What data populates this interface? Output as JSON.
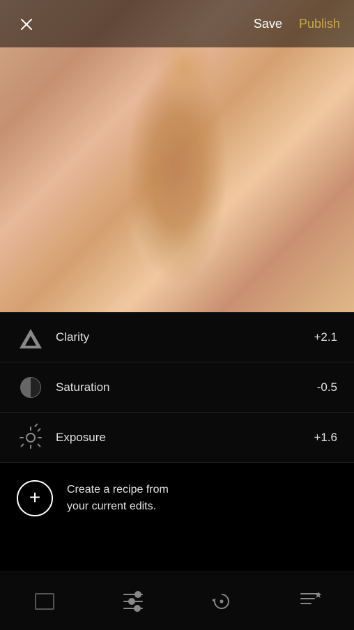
{
  "header": {
    "save_label": "Save",
    "publish_label": "Publish"
  },
  "adjustments": {
    "items": [
      {
        "name": "Clarity",
        "value": "+2.1",
        "icon": "clarity-icon"
      },
      {
        "name": "Saturation",
        "value": "-0.5",
        "icon": "saturation-icon"
      },
      {
        "name": "Exposure",
        "value": "+1.6",
        "icon": "exposure-icon"
      }
    ]
  },
  "recipe": {
    "line1": "Create a recipe from",
    "line2": "your current edits."
  },
  "bottom_nav": {
    "items": [
      {
        "label": "crop",
        "icon": "crop-icon"
      },
      {
        "label": "adjust",
        "icon": "sliders-icon"
      },
      {
        "label": "history",
        "icon": "history-icon"
      },
      {
        "label": "recipes",
        "icon": "recipes-icon"
      }
    ]
  }
}
